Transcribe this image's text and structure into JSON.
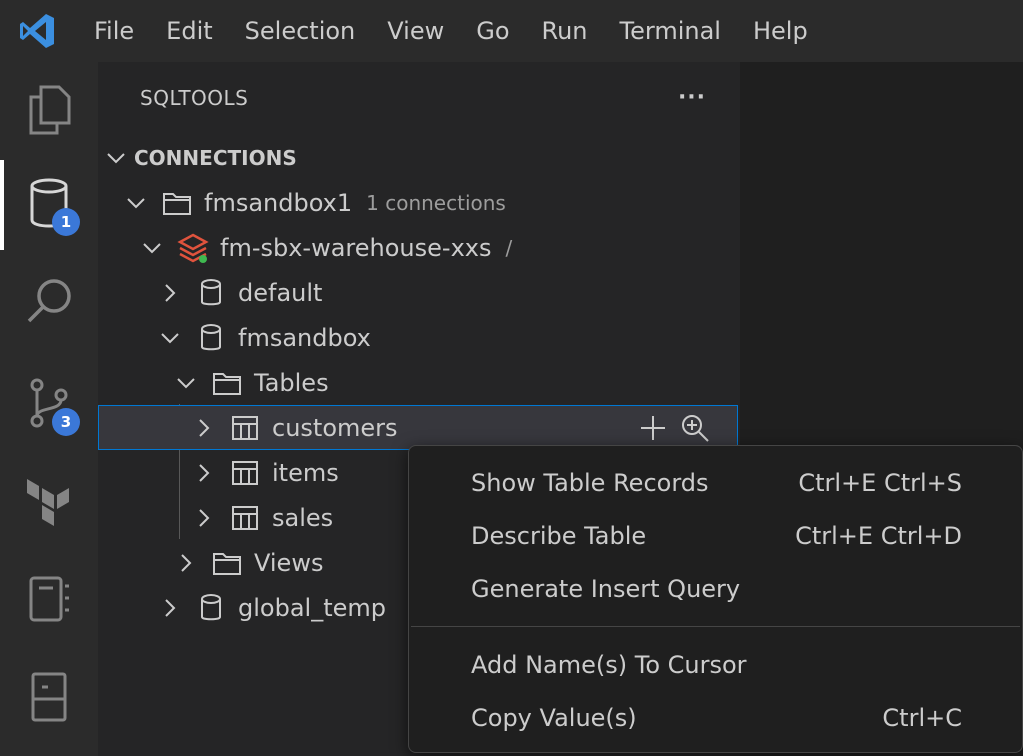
{
  "menubar": {
    "logo_icon": "vscode-logo-icon",
    "items": [
      "File",
      "Edit",
      "Selection",
      "View",
      "Go",
      "Run",
      "Terminal",
      "Help"
    ]
  },
  "activitybar": {
    "items": [
      {
        "icon": "explorer-icon"
      },
      {
        "icon": "database-icon",
        "badge": "1"
      },
      {
        "icon": "search-icon"
      },
      {
        "icon": "source-control-icon",
        "badge": "3"
      },
      {
        "icon": "terraform-icon"
      },
      {
        "icon": "notebook-icon"
      },
      {
        "icon": "remote-explorer-icon"
      }
    ]
  },
  "sidebar": {
    "title": "SQLTOOLS",
    "more_label": "···",
    "section": "CONNECTIONS",
    "tree": {
      "group": {
        "label": "fmsandbox1",
        "desc": "1 connections"
      },
      "connection": {
        "label": "fm-sbx-warehouse-xxs",
        "desc": "/"
      },
      "db_default": "default",
      "db_fmsandbox": "fmsandbox",
      "tables_folder": "Tables",
      "tables": [
        "customers",
        "items",
        "sales"
      ],
      "views_folder": "Views",
      "db_global_temp": "global_temp"
    }
  },
  "context_menu": {
    "items": [
      {
        "label": "Show Table Records",
        "shortcut": "Ctrl+E Ctrl+S"
      },
      {
        "label": "Describe Table",
        "shortcut": "Ctrl+E Ctrl+D"
      },
      {
        "label": "Generate Insert Query",
        "shortcut": ""
      },
      {
        "label": "Add Name(s) To Cursor",
        "shortcut": ""
      },
      {
        "label": "Copy Value(s)",
        "shortcut": "Ctrl+C"
      }
    ]
  },
  "colors": {
    "accent": "#0078d4",
    "badge": "#3b78d8",
    "connection_icon": "#e0533d",
    "status_dot": "#3fb950"
  }
}
